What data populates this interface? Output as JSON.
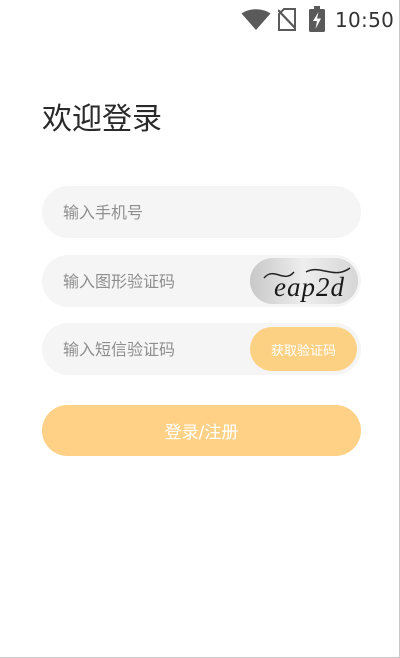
{
  "status_bar": {
    "time": "10:50",
    "icons": [
      "wifi-icon",
      "no-sim-icon",
      "battery-charging-icon"
    ]
  },
  "page": {
    "title": "欢迎登录"
  },
  "form": {
    "phone_placeholder": "输入手机号",
    "captcha_placeholder": "输入图形验证码",
    "captcha_text": "eap2d",
    "sms_placeholder": "输入短信验证码",
    "get_code_label": "获取验证码",
    "submit_label": "登录/注册"
  },
  "colors": {
    "accent": "#fed186",
    "input_bg": "#f5f5f5",
    "placeholder": "#8e8e8e",
    "title": "#2a2a2a"
  }
}
